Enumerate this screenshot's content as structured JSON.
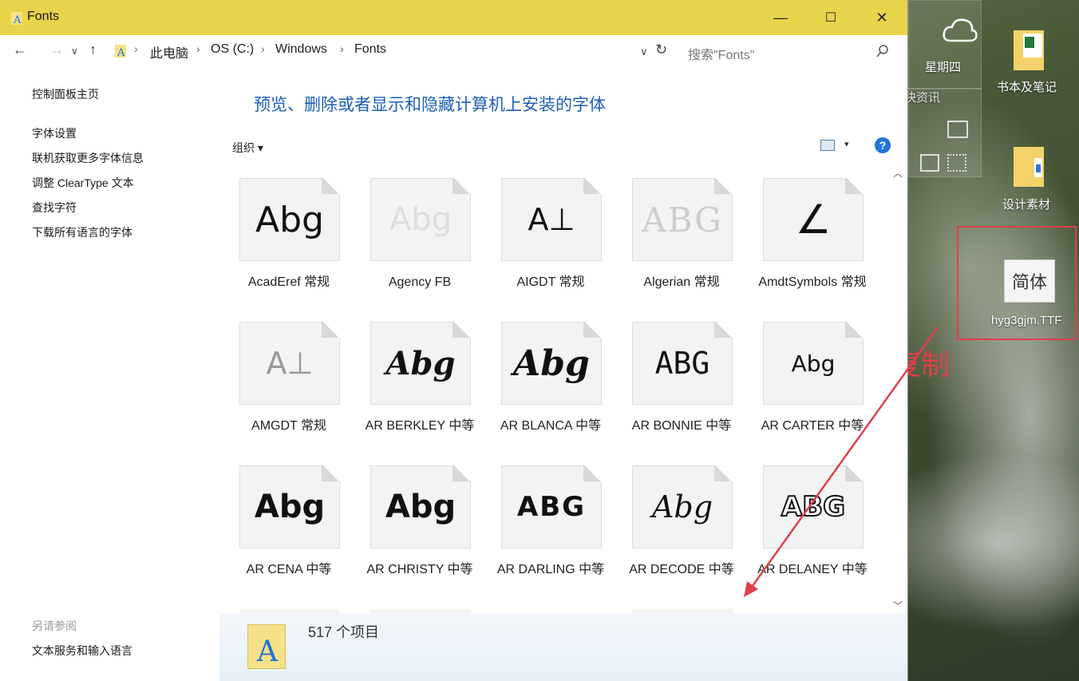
{
  "window": {
    "title": "Fonts",
    "minimize": "—",
    "maximize": "☐",
    "close": "✕"
  },
  "address": {
    "crumbs": [
      "此电脑",
      "OS (C:)",
      "Windows",
      "Fonts"
    ],
    "search_placeholder": "搜索\"Fonts\""
  },
  "left_panel": {
    "home": "控制面板主页",
    "links": [
      "字体设置",
      "联机获取更多字体信息",
      "调整 ClearType 文本",
      "查找字符",
      "下载所有语言的字体"
    ],
    "see_also_heading": "另请参阅",
    "see_also_link": "文本服务和输入语言"
  },
  "main": {
    "title": "预览、删除或者显示和隐藏计算机上安装的字体",
    "organize": "组织 ▾",
    "help": "?"
  },
  "fonts": [
    {
      "label": "AcadEref 常规",
      "sample": "Abg"
    },
    {
      "label": "Agency FB",
      "sample": "Abg"
    },
    {
      "label": "AIGDT 常规",
      "sample": "A⊥"
    },
    {
      "label": "Algerian 常规",
      "sample": "ABG"
    },
    {
      "label": "AmdtSymbols 常规",
      "sample": "∠"
    },
    {
      "label": "AMGDT 常规",
      "sample": "A⊥"
    },
    {
      "label": "AR BERKLEY 中等",
      "sample": "Abg"
    },
    {
      "label": "AR BLANCA 中等",
      "sample": "Abg"
    },
    {
      "label": "AR BONNIE 中等",
      "sample": "ABG"
    },
    {
      "label": "AR CARTER 中等",
      "sample": "Abg"
    },
    {
      "label": "AR CENA 中等",
      "sample": "Abg"
    },
    {
      "label": "AR CHRISTY 中等",
      "sample": "Abg"
    },
    {
      "label": "AR DARLING 中等",
      "sample": "ABG"
    },
    {
      "label": "AR DECODE 中等",
      "sample": "Abg"
    },
    {
      "label": "AR DELANEY 中等",
      "sample": "ABG"
    }
  ],
  "details": {
    "count": "517 个项目",
    "icon_letter": "A"
  },
  "desktop": {
    "weekday": "星期四",
    "news_label": "快资讯",
    "items": [
      {
        "label": "书本及笔记"
      },
      {
        "label": "设计素材"
      },
      {
        "label": "hyg3gjm.TTF",
        "icon_text": "简体"
      }
    ],
    "annotation": "复制",
    "annotation_color": "#e0404a"
  }
}
